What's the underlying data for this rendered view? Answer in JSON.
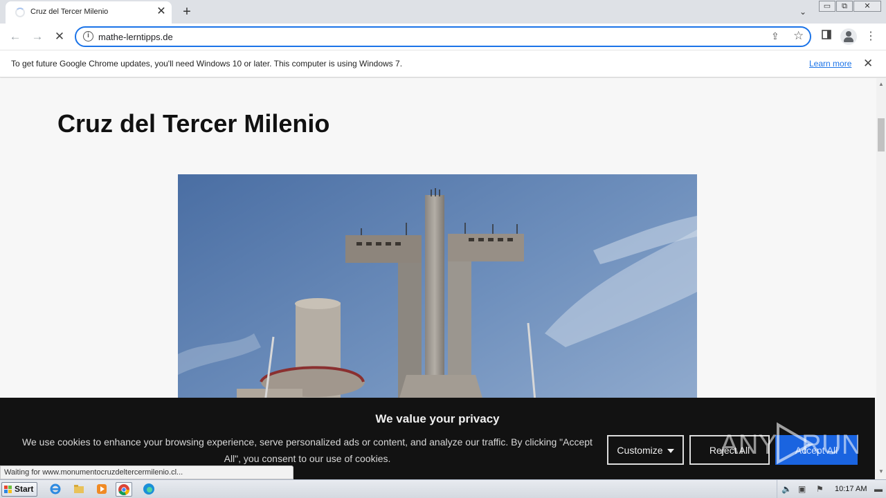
{
  "browser": {
    "tab": {
      "title": "Cruz del Tercer Milenio"
    },
    "address": {
      "url": "mathe-lerntipps.de"
    }
  },
  "infobar": {
    "message": "To get future Google Chrome updates, you'll need Windows 10 or later. This computer is using Windows 7.",
    "link": "Learn more"
  },
  "page": {
    "heading": "Cruz del Tercer Milenio"
  },
  "cookie": {
    "title": "We value your privacy",
    "text": "We use cookies to enhance your browsing experience, serve personalized ads or content, and analyze our traffic. By clicking \"Accept All\", you consent to our use of cookies.",
    "customize": "Customize",
    "reject": "Reject All",
    "accept": "Accept All"
  },
  "status": "Waiting for www.monumentocruzdeltercermilenio.cl...",
  "taskbar": {
    "start": "Start",
    "clock": "10:17 AM"
  },
  "watermark": {
    "text": "ANY RUN"
  }
}
